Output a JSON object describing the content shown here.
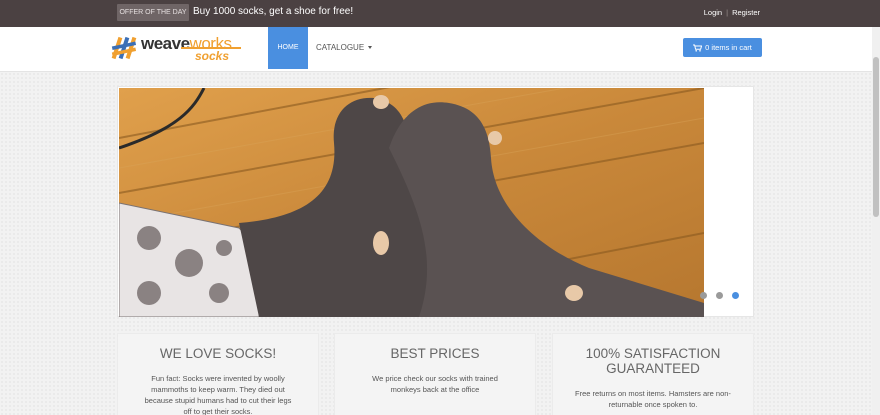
{
  "topbar": {
    "offer_badge": "OFFER OF THE DAY",
    "offer_text": "Buy 1000 socks, get a shoe for free!",
    "login": "Login",
    "register": "Register"
  },
  "nav": {
    "logo_word_primary": "weave",
    "logo_word_secondary": "works",
    "logo_socks": "socks",
    "home": "HOME",
    "catalogue": "CATALOGUE",
    "cart": "0 items in cart"
  },
  "carousel": {
    "slide_count": 3,
    "active_index": 2
  },
  "features": [
    {
      "title": "WE LOVE SOCKS!",
      "text": "Fun fact: Socks were invented by woolly mammoths to keep warm. They died out because stupid humans had to cut their legs off to get their socks."
    },
    {
      "title": "BEST PRICES",
      "text": "We price check our socks with trained monkeys back at the office"
    },
    {
      "title": "100% SATISFACTION GUARANTEED",
      "text": "Free returns on most items. Hamsters are non-returnable once spoken to."
    }
  ],
  "colors": {
    "topbar_bg": "#4b4142",
    "accent": "#4a8fe0",
    "brand_orange": "#f0a030"
  }
}
